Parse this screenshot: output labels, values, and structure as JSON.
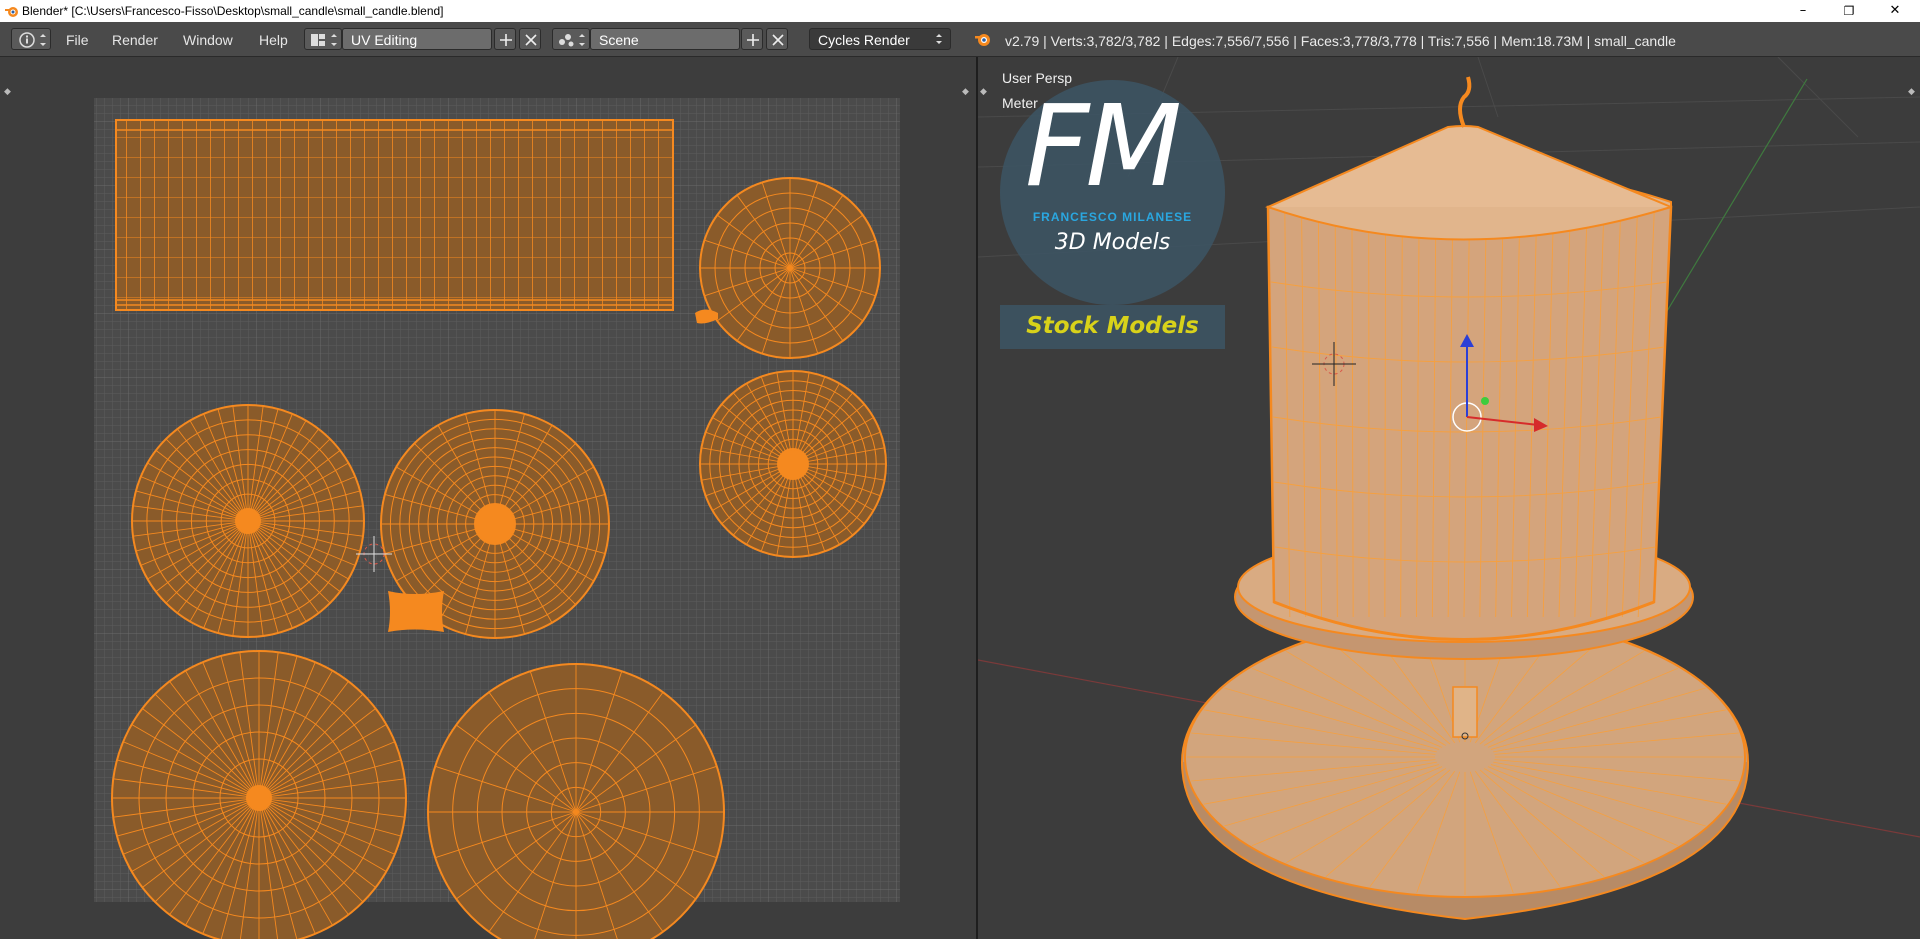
{
  "titlebar": {
    "title": "Blender* [C:\\Users\\Francesco-Fisso\\Desktop\\small_candle\\small_candle.blend]",
    "minimize": "–",
    "restore": "❐",
    "close": "✕"
  },
  "menu": {
    "items": [
      "File",
      "Render",
      "Window",
      "Help"
    ]
  },
  "layout": {
    "screen": "UV Editing",
    "scene": "Scene",
    "engine": "Cycles Render"
  },
  "stats": {
    "text": "v2.79 | Verts:3,782/3,782 | Edges:7,556/7,556 | Faces:3,778/3,778 | Tris:7,556 | Mem:18.73M | small_candle"
  },
  "viewport": {
    "view_name": "User Persp",
    "units": "Meter"
  },
  "watermark": {
    "logo_letters": "FM",
    "name": "FRANCESCO MILANESE",
    "subtitle": "3D Models",
    "banner": "Stock Models"
  },
  "colors": {
    "accent": "#f5891f",
    "uv_fill": "#8a5a2a",
    "ui_bg": "#4a4a4a",
    "logo_blue": "#2aa7e0",
    "banner_text": "#d8d21a"
  },
  "icons": {
    "info": "info-icon",
    "blender": "blender-logo-icon",
    "add": "plus-icon",
    "remove": "close-x-icon"
  }
}
